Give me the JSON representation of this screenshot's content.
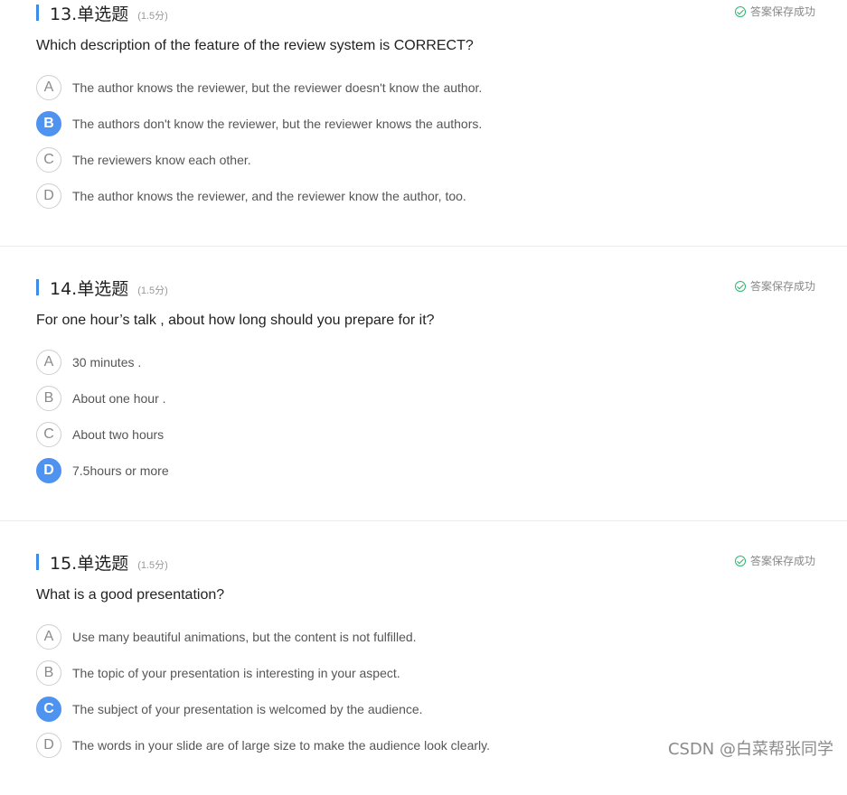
{
  "saved_label": "答案保存成功",
  "q1": {
    "number": "13.单选题",
    "score": "(1.5分)",
    "stem": "Which description of the feature of the review system is CORRECT?",
    "options": [
      {
        "letter": "A",
        "text": "The author knows the reviewer, but the reviewer doesn't know the author."
      },
      {
        "letter": "B",
        "text": "The authors don't know the reviewer, but the reviewer knows the authors."
      },
      {
        "letter": "C",
        "text": "The reviewers know each other."
      },
      {
        "letter": "D",
        "text": "The author knows the reviewer, and the reviewer know the author, too."
      }
    ],
    "selected": "B"
  },
  "q2": {
    "number": "14.单选题",
    "score": "(1.5分)",
    "stem": "For one hour’s talk , about how long should you prepare for it?",
    "options": [
      {
        "letter": "A",
        "text": "30 minutes ."
      },
      {
        "letter": "B",
        "text": "About one hour ."
      },
      {
        "letter": "C",
        "text": "About two hours"
      },
      {
        "letter": "D",
        "text": "7.5hours or more"
      }
    ],
    "selected": "D"
  },
  "q3": {
    "number": "15.单选题",
    "score": "(1.5分)",
    "stem": "What is a good presentation?",
    "options": [
      {
        "letter": "A",
        "text": "Use many beautiful animations, but the content is not fulfilled."
      },
      {
        "letter": "B",
        "text": "The topic of your presentation is interesting in your aspect."
      },
      {
        "letter": "C",
        "text": "The subject of your presentation is welcomed by the audience."
      },
      {
        "letter": "D",
        "text": "The words in your slide are of large size to make the audience look clearly."
      }
    ],
    "selected": "C"
  },
  "watermark": "CSDN @白菜帮张同学",
  "colors": {
    "accent": "#4e93f0",
    "saved": "#2fb56b"
  }
}
